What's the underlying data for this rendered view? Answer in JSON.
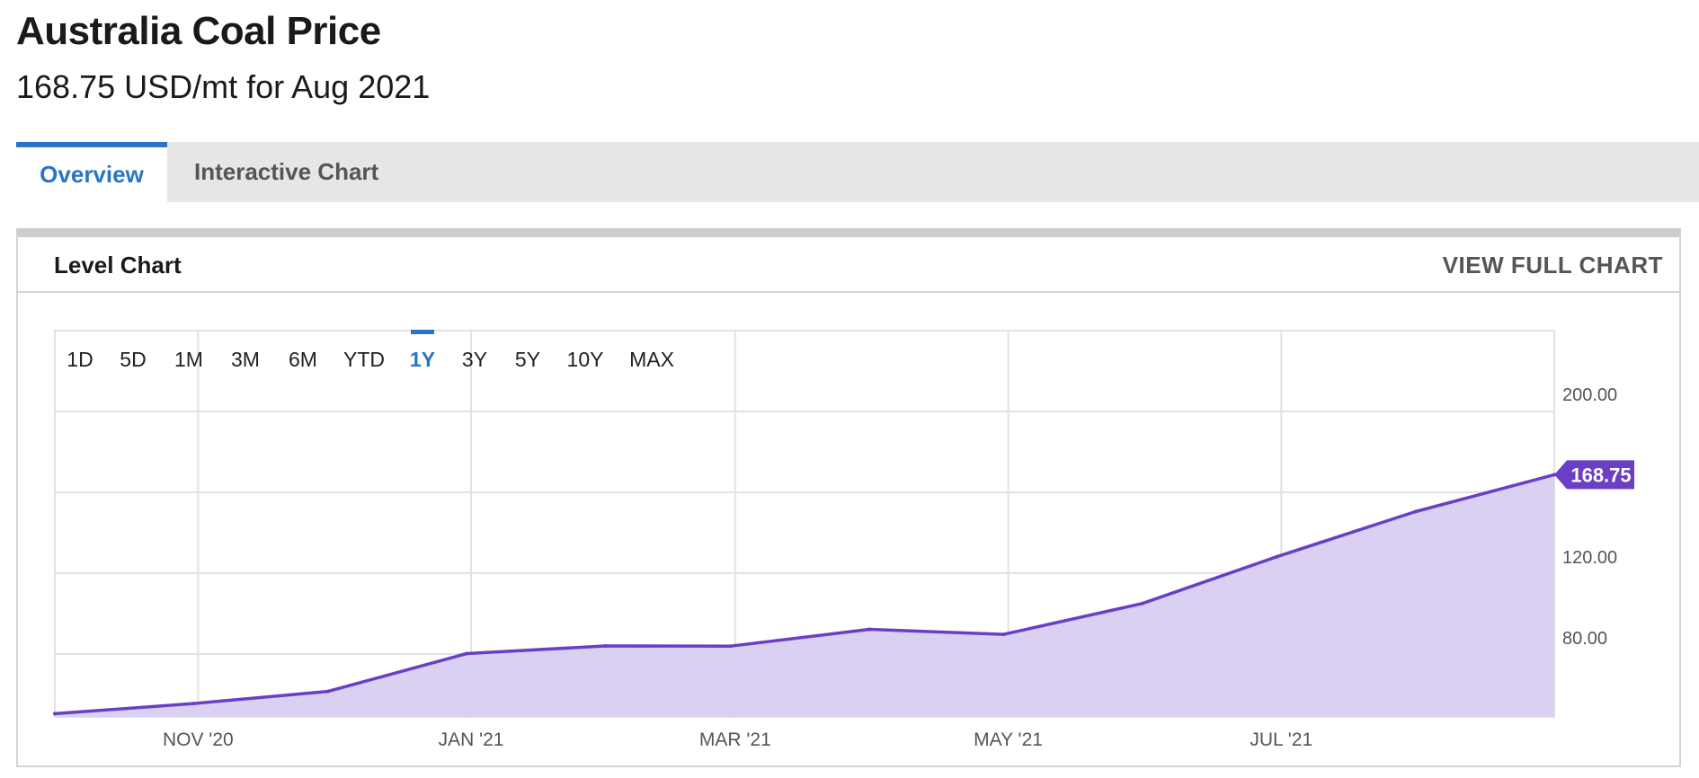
{
  "header": {
    "title": "Australia Coal Price",
    "subtitle": "168.75 USD/mt for Aug 2021"
  },
  "tabs": [
    {
      "label": "Overview",
      "active": true
    },
    {
      "label": "Interactive Chart",
      "active": false
    }
  ],
  "panel": {
    "title": "Level Chart",
    "view_full_label": "VIEW FULL CHART"
  },
  "range_buttons": [
    {
      "label": "1D",
      "active": false
    },
    {
      "label": "5D",
      "active": false
    },
    {
      "label": "1M",
      "active": false
    },
    {
      "label": "3M",
      "active": false
    },
    {
      "label": "6M",
      "active": false
    },
    {
      "label": "YTD",
      "active": false
    },
    {
      "label": "1Y",
      "active": true
    },
    {
      "label": "3Y",
      "active": false
    },
    {
      "label": "5Y",
      "active": false
    },
    {
      "label": "10Y",
      "active": false
    },
    {
      "label": "MAX",
      "active": false
    }
  ],
  "colors": {
    "accent": "#2a74c6",
    "series_line": "#6a3fc4",
    "series_fill": "#d8cdf0",
    "badge": "#6a3fc4",
    "grid": "#e2e2e2"
  },
  "chart_data": {
    "type": "area",
    "title": "Australia Coal Price",
    "x": [
      "2020-09-30",
      "2020-10-31",
      "2020-11-30",
      "2020-12-31",
      "2021-01-31",
      "2021-02-28",
      "2021-03-31",
      "2021-04-30",
      "2021-05-31",
      "2021-06-30",
      "2021-07-31",
      "2021-08-31"
    ],
    "series": [
      {
        "values": [
          50.6,
          55.6,
          61.6,
          80.3,
          84.1,
          84.0,
          92.3,
          89.8,
          105.1,
          128.2,
          150.5,
          168.75
        ]
      }
    ],
    "x_ticks": [
      "NOV '20",
      "JAN '21",
      "MAR '21",
      "MAY '21",
      "JUL '21"
    ],
    "y_ticks": [
      "80.00",
      "120.00",
      "200.00"
    ],
    "ylim": [
      49,
      240
    ],
    "last_value_label": "168.75",
    "grid": true
  }
}
